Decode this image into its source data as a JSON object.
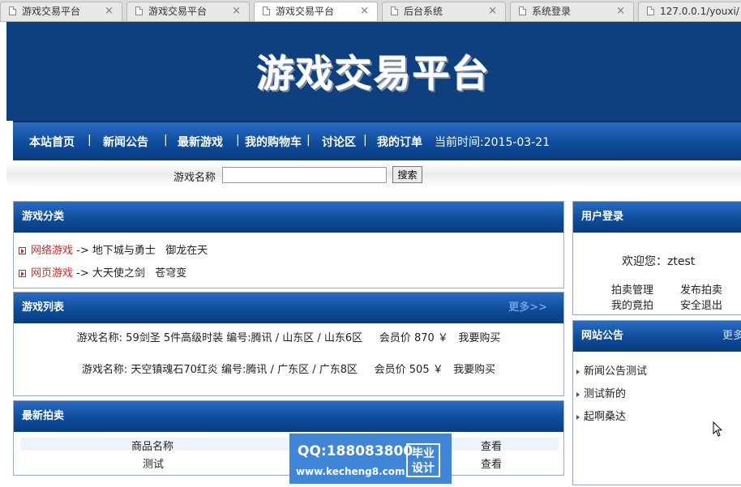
{
  "browser": {
    "tabs": [
      {
        "label": "游戏交易平台",
        "active": false
      },
      {
        "label": "游戏交易平台",
        "active": false
      },
      {
        "label": "游戏交易平台",
        "active": true
      },
      {
        "label": "后台系统",
        "active": false
      },
      {
        "label": "系统登录",
        "active": false
      },
      {
        "label": "127.0.0.1/youxi/",
        "active": false
      }
    ],
    "close_glyph": "×"
  },
  "header": {
    "title": "游戏交易平台"
  },
  "nav": {
    "items": [
      "本站首页",
      "新闻公告",
      "最新游戏",
      "我的购物车",
      "讨论区",
      "我的订单"
    ],
    "separator": "|",
    "date_text": "当前时间:2015-03-21"
  },
  "search": {
    "label": "游戏名称",
    "value": "",
    "button": "搜索"
  },
  "categories": {
    "title": "游戏分类",
    "rows": [
      {
        "name": "网络游戏",
        "arrow": "->",
        "games": "地下城与勇士   御龙在天"
      },
      {
        "name": "网页游戏",
        "arrow": "->",
        "games": "大天使之剑   苍穹变"
      }
    ]
  },
  "game_list": {
    "title": "游戏列表",
    "more": "更多>>",
    "items": [
      "游戏名称: 59剑圣 5件高级时装 编号:腾讯 / 山东区 / 山东6区     会员价 870 ￥   我要购买",
      "游戏名称: 天空镇魂石70红炎 编号:腾讯 / 广东区 / 广东8区     会员价 505 ￥   我要购买"
    ]
  },
  "auctions": {
    "title": "最新拍卖",
    "columns": [
      "商品名称",
      "查看"
    ],
    "rows": [
      {
        "name": "测试",
        "action": "查看"
      }
    ]
  },
  "login": {
    "title": "用户登录",
    "welcome": "欢迎您：ztest",
    "links": [
      "拍卖管理",
      "发布拍卖",
      "我的竟拍",
      "安全退出"
    ]
  },
  "notices": {
    "title": "网站公告",
    "more": "更多",
    "items": [
      "新闻公告测试",
      "测试新的",
      "起啊桑达"
    ]
  },
  "watermark": {
    "qq": "QQ:188083800",
    "url": "www.kecheng8.com",
    "badge_line1": "毕业",
    "badge_line2": "设计"
  },
  "colors": {
    "header_blue": "#0e3f7e",
    "bar_blue": "#0e4c9a",
    "accent_red": "#dd2222"
  }
}
